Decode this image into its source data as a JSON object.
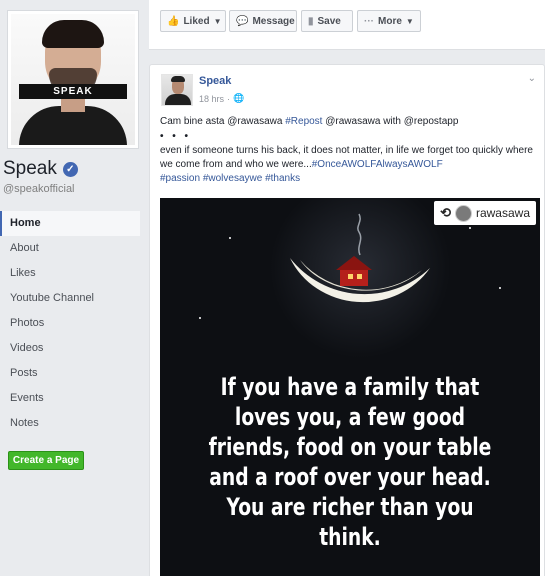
{
  "profile": {
    "photo_caption": "SPEAK",
    "name": "Speak",
    "handle": "@speakofficial",
    "verified_icon": "check-icon"
  },
  "nav": {
    "items": [
      {
        "label": "Home",
        "active": true
      },
      {
        "label": "About"
      },
      {
        "label": "Likes"
      },
      {
        "label": "Youtube Channel"
      },
      {
        "label": "Photos"
      },
      {
        "label": "Videos"
      },
      {
        "label": "Posts"
      },
      {
        "label": "Events"
      },
      {
        "label": "Notes"
      }
    ],
    "create_page": "Create a Page"
  },
  "actions": {
    "liked": "Liked",
    "message": "Message",
    "save": "Save",
    "more": "More"
  },
  "post": {
    "author": "Speak",
    "time": "18 hrs",
    "privacy_icon": "globe-icon",
    "line1_prefix": "Cam bine asta @rawasawa ",
    "line1_tag": "#Repost",
    "line1_suffix": " @rawasawa with @repostapp",
    "dots": "• • •",
    "body_text": "even if someone turns his back, it does not matter, in life we forget too quickly where we come from and who we were...",
    "body_tag1": "#OnceAWOLFAlwaysAWOLF",
    "body_tag2": "#passion",
    "body_tag3": "#wolvesaywe",
    "body_tag4": "#thanks",
    "image": {
      "repost_user": "rawasawa",
      "quote": "If you have a family that loves you, a few good friends, food on your table and a roof over your head. You are richer than you think."
    }
  },
  "colors": {
    "brand_blue": "#4267b2",
    "link_blue": "#365899",
    "green": "#42b72a",
    "background": "#e9ebee"
  }
}
